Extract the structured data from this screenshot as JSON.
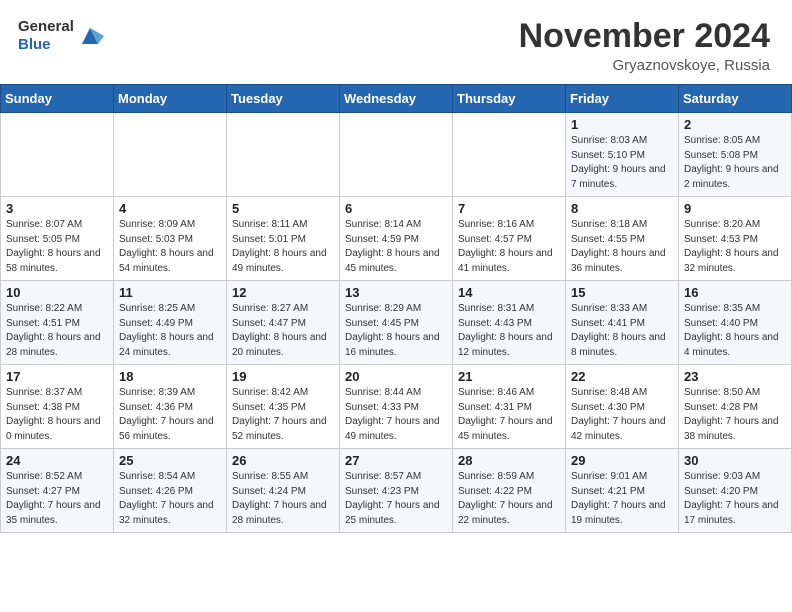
{
  "header": {
    "logo_line1": "General",
    "logo_line2": "Blue",
    "month_title": "November 2024",
    "location": "Gryaznovskoye, Russia"
  },
  "weekdays": [
    "Sunday",
    "Monday",
    "Tuesday",
    "Wednesday",
    "Thursday",
    "Friday",
    "Saturday"
  ],
  "weeks": [
    [
      {
        "day": "",
        "info": ""
      },
      {
        "day": "",
        "info": ""
      },
      {
        "day": "",
        "info": ""
      },
      {
        "day": "",
        "info": ""
      },
      {
        "day": "",
        "info": ""
      },
      {
        "day": "1",
        "info": "Sunrise: 8:03 AM\nSunset: 5:10 PM\nDaylight: 9 hours\nand 7 minutes."
      },
      {
        "day": "2",
        "info": "Sunrise: 8:05 AM\nSunset: 5:08 PM\nDaylight: 9 hours\nand 2 minutes."
      }
    ],
    [
      {
        "day": "3",
        "info": "Sunrise: 8:07 AM\nSunset: 5:05 PM\nDaylight: 8 hours\nand 58 minutes."
      },
      {
        "day": "4",
        "info": "Sunrise: 8:09 AM\nSunset: 5:03 PM\nDaylight: 8 hours\nand 54 minutes."
      },
      {
        "day": "5",
        "info": "Sunrise: 8:11 AM\nSunset: 5:01 PM\nDaylight: 8 hours\nand 49 minutes."
      },
      {
        "day": "6",
        "info": "Sunrise: 8:14 AM\nSunset: 4:59 PM\nDaylight: 8 hours\nand 45 minutes."
      },
      {
        "day": "7",
        "info": "Sunrise: 8:16 AM\nSunset: 4:57 PM\nDaylight: 8 hours\nand 41 minutes."
      },
      {
        "day": "8",
        "info": "Sunrise: 8:18 AM\nSunset: 4:55 PM\nDaylight: 8 hours\nand 36 minutes."
      },
      {
        "day": "9",
        "info": "Sunrise: 8:20 AM\nSunset: 4:53 PM\nDaylight: 8 hours\nand 32 minutes."
      }
    ],
    [
      {
        "day": "10",
        "info": "Sunrise: 8:22 AM\nSunset: 4:51 PM\nDaylight: 8 hours\nand 28 minutes."
      },
      {
        "day": "11",
        "info": "Sunrise: 8:25 AM\nSunset: 4:49 PM\nDaylight: 8 hours\nand 24 minutes."
      },
      {
        "day": "12",
        "info": "Sunrise: 8:27 AM\nSunset: 4:47 PM\nDaylight: 8 hours\nand 20 minutes."
      },
      {
        "day": "13",
        "info": "Sunrise: 8:29 AM\nSunset: 4:45 PM\nDaylight: 8 hours\nand 16 minutes."
      },
      {
        "day": "14",
        "info": "Sunrise: 8:31 AM\nSunset: 4:43 PM\nDaylight: 8 hours\nand 12 minutes."
      },
      {
        "day": "15",
        "info": "Sunrise: 8:33 AM\nSunset: 4:41 PM\nDaylight: 8 hours\nand 8 minutes."
      },
      {
        "day": "16",
        "info": "Sunrise: 8:35 AM\nSunset: 4:40 PM\nDaylight: 8 hours\nand 4 minutes."
      }
    ],
    [
      {
        "day": "17",
        "info": "Sunrise: 8:37 AM\nSunset: 4:38 PM\nDaylight: 8 hours\nand 0 minutes."
      },
      {
        "day": "18",
        "info": "Sunrise: 8:39 AM\nSunset: 4:36 PM\nDaylight: 7 hours\nand 56 minutes."
      },
      {
        "day": "19",
        "info": "Sunrise: 8:42 AM\nSunset: 4:35 PM\nDaylight: 7 hours\nand 52 minutes."
      },
      {
        "day": "20",
        "info": "Sunrise: 8:44 AM\nSunset: 4:33 PM\nDaylight: 7 hours\nand 49 minutes."
      },
      {
        "day": "21",
        "info": "Sunrise: 8:46 AM\nSunset: 4:31 PM\nDaylight: 7 hours\nand 45 minutes."
      },
      {
        "day": "22",
        "info": "Sunrise: 8:48 AM\nSunset: 4:30 PM\nDaylight: 7 hours\nand 42 minutes."
      },
      {
        "day": "23",
        "info": "Sunrise: 8:50 AM\nSunset: 4:28 PM\nDaylight: 7 hours\nand 38 minutes."
      }
    ],
    [
      {
        "day": "24",
        "info": "Sunrise: 8:52 AM\nSunset: 4:27 PM\nDaylight: 7 hours\nand 35 minutes."
      },
      {
        "day": "25",
        "info": "Sunrise: 8:54 AM\nSunset: 4:26 PM\nDaylight: 7 hours\nand 32 minutes."
      },
      {
        "day": "26",
        "info": "Sunrise: 8:55 AM\nSunset: 4:24 PM\nDaylight: 7 hours\nand 28 minutes."
      },
      {
        "day": "27",
        "info": "Sunrise: 8:57 AM\nSunset: 4:23 PM\nDaylight: 7 hours\nand 25 minutes."
      },
      {
        "day": "28",
        "info": "Sunrise: 8:59 AM\nSunset: 4:22 PM\nDaylight: 7 hours\nand 22 minutes."
      },
      {
        "day": "29",
        "info": "Sunrise: 9:01 AM\nSunset: 4:21 PM\nDaylight: 7 hours\nand 19 minutes."
      },
      {
        "day": "30",
        "info": "Sunrise: 9:03 AM\nSunset: 4:20 PM\nDaylight: 7 hours\nand 17 minutes."
      }
    ]
  ]
}
